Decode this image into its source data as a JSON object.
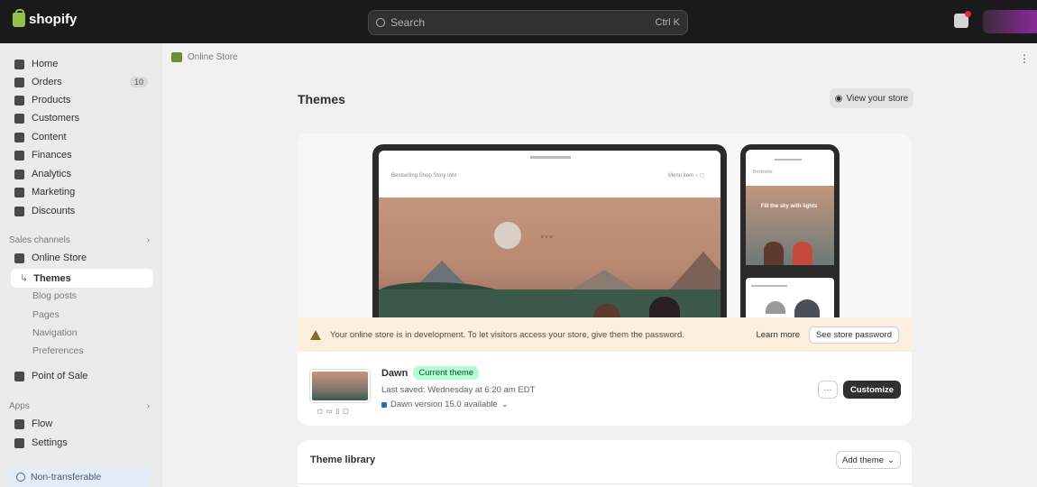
{
  "topbar": {
    "logo_text": "shopify",
    "search_placeholder": "Search",
    "search_shortcut": "Ctrl K"
  },
  "sidebar": {
    "items": [
      {
        "label": "Home"
      },
      {
        "label": "Orders",
        "badge": "10"
      },
      {
        "label": "Products"
      },
      {
        "label": "Customers"
      },
      {
        "label": "Content"
      },
      {
        "label": "Finances"
      },
      {
        "label": "Analytics"
      },
      {
        "label": "Marketing"
      },
      {
        "label": "Discounts"
      }
    ],
    "sales_channels_label": "Sales channels",
    "online_store_label": "Online Store",
    "themes_label": "Themes",
    "sub_items": [
      "Blog posts",
      "Pages",
      "Navigation",
      "Preferences"
    ],
    "point_of_sale_label": "Point of Sale",
    "apps_label": "Apps",
    "flow_label": "Flow",
    "settings_label": "Settings",
    "non_transferable_label": "Non-transferable"
  },
  "breadcrumb": {
    "label": "Online Store"
  },
  "page": {
    "title": "Themes",
    "view_password_label": "View your store"
  },
  "preview": {
    "site_menu": "Bestselling   Shop   Story   Info",
    "site_icons": "Menu item   ○   ◻",
    "phone_menu": "Bestseller",
    "phone_hero_text": "Fill the sky with lights"
  },
  "banner": {
    "text": "Your online store is in development. To let visitors access your store, give them the password.",
    "learn_more": "Learn more",
    "button_label": "See store password"
  },
  "current_theme": {
    "name": "Dawn",
    "status": "Current theme",
    "last_saved": "Last saved: Wednesday at 6:20 am EDT",
    "version": "Dawn version 15.0 available",
    "more_label": "···",
    "customize_label": "Customize",
    "device_icons": "◻ ▭ ▯ ▢"
  },
  "library": {
    "title": "Theme library",
    "add_theme_label": "Add theme"
  },
  "colors": {
    "topbar": "#1a1a1a",
    "live_badge": "#b4fed2",
    "banner": "#fbeede",
    "primary_button": "#303030"
  }
}
